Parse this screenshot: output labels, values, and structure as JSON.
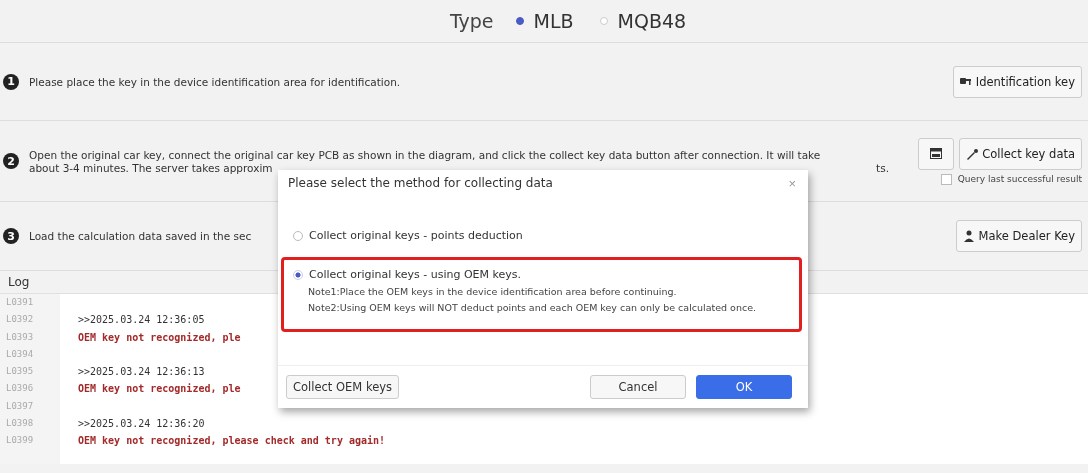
{
  "type_selector": {
    "label": "Type",
    "options": [
      {
        "label": "MLB",
        "selected": true
      },
      {
        "label": "MQB48",
        "selected": false
      }
    ]
  },
  "steps": [
    {
      "number": "1",
      "lines": [
        [
          "Please place the key in the device identification area for identification."
        ]
      ],
      "buttons": [
        {
          "kind": "text",
          "label": "Identification key"
        }
      ]
    },
    {
      "number": "2",
      "lines": [
        [
          "Open the original car key, connect the original car key PCB as shown in the diagram, and click the collect key data button after connection. It will take"
        ],
        [
          "about 3-4 minutes. The server takes approxim",
          "ts."
        ]
      ],
      "buttons": [
        {
          "kind": "icon"
        },
        {
          "kind": "text",
          "label": "Collect key data"
        }
      ],
      "checkbox": {
        "label": "Query last successful result",
        "checked": false
      }
    },
    {
      "number": "3",
      "lines": [
        [
          "Load the calculation data saved in the sec"
        ]
      ],
      "buttons": [
        {
          "kind": "text",
          "label": "Make Dealer Key"
        }
      ]
    }
  ],
  "log": {
    "title": "Log",
    "rows": [
      {
        "line": "L0391",
        "text": "",
        "kind": "plain"
      },
      {
        "line": "L0392",
        "text": ">>2025.03.24 12:36:05",
        "kind": "plain"
      },
      {
        "line": "L0393",
        "text": "OEM key not recognized, ple",
        "kind": "error"
      },
      {
        "line": "L0394",
        "text": "",
        "kind": "plain"
      },
      {
        "line": "L0395",
        "text": ">>2025.03.24 12:36:13",
        "kind": "plain"
      },
      {
        "line": "L0396",
        "text": "OEM key not recognized, ple",
        "kind": "error"
      },
      {
        "line": "L0397",
        "text": "",
        "kind": "plain"
      },
      {
        "line": "L0398",
        "text": ">>2025.03.24 12:36:20",
        "kind": "plain"
      },
      {
        "line": "L0399",
        "text": "OEM key not recognized, please check and try again!",
        "kind": "error"
      }
    ]
  },
  "dialog": {
    "title": "Please select the method for collecting data",
    "close": "×",
    "options": [
      {
        "label": "Collect original keys - points deduction",
        "selected": false,
        "highlighted": false
      },
      {
        "label": "Collect original keys - using OEM keys.",
        "selected": true,
        "highlighted": true,
        "notes": [
          "Note1:Place the OEM keys in the device identification area before continuing.",
          "Note2:Using OEM keys will NOT deduct points and each OEM key can only be calculated once."
        ]
      }
    ],
    "buttons": [
      {
        "kind": "secondary",
        "label": "Collect OEM keys"
      },
      {
        "kind": "spacer"
      },
      {
        "kind": "secondary",
        "label": "Cancel"
      },
      {
        "kind": "primary",
        "label": "OK"
      }
    ]
  }
}
